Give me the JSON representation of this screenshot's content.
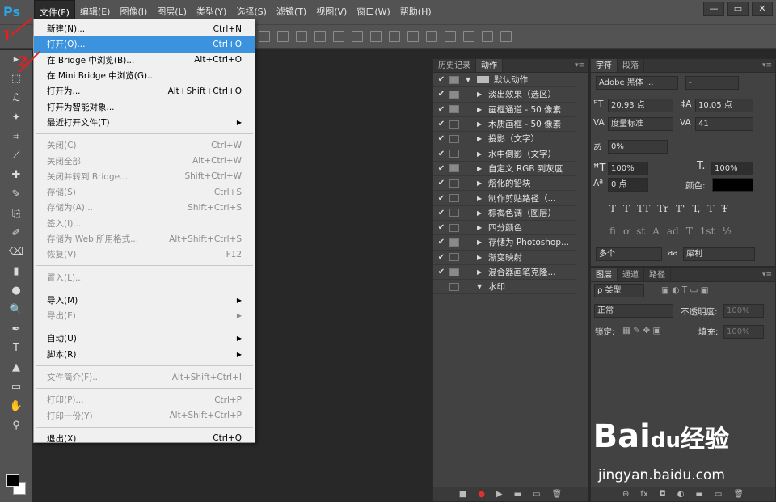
{
  "app": {
    "logo": "Ps"
  },
  "menubar": {
    "items": [
      "文件(F)",
      "编辑(E)",
      "图像(I)",
      "图层(L)",
      "类型(Y)",
      "选择(S)",
      "滤镜(T)",
      "视图(V)",
      "窗口(W)",
      "帮助(H)"
    ]
  },
  "window_controls": {
    "minimize": "—",
    "restore": "▭",
    "close": "✕"
  },
  "file_menu": {
    "items": [
      {
        "label": "新建(N)...",
        "shortcut": "Ctrl+N",
        "state": "enabled"
      },
      {
        "label": "打开(O)...",
        "shortcut": "Ctrl+O",
        "state": "highlighted"
      },
      {
        "label": "在 Bridge 中浏览(B)...",
        "shortcut": "Alt+Ctrl+O",
        "state": "enabled"
      },
      {
        "label": "在 Mini Bridge 中浏览(G)...",
        "shortcut": "",
        "state": "enabled"
      },
      {
        "label": "打开为...",
        "shortcut": "Alt+Shift+Ctrl+O",
        "state": "enabled"
      },
      {
        "label": "打开为智能对象...",
        "shortcut": "",
        "state": "enabled"
      },
      {
        "label": "最近打开文件(T)",
        "shortcut": "▶",
        "state": "enabled"
      },
      {
        "sep": true
      },
      {
        "label": "关闭(C)",
        "shortcut": "Ctrl+W",
        "state": "disabled"
      },
      {
        "label": "关闭全部",
        "shortcut": "Alt+Ctrl+W",
        "state": "disabled"
      },
      {
        "label": "关闭并转到 Bridge...",
        "shortcut": "Shift+Ctrl+W",
        "state": "disabled"
      },
      {
        "label": "存储(S)",
        "shortcut": "Ctrl+S",
        "state": "disabled"
      },
      {
        "label": "存储为(A)...",
        "shortcut": "Shift+Ctrl+S",
        "state": "disabled"
      },
      {
        "label": "签入(I)...",
        "shortcut": "",
        "state": "disabled"
      },
      {
        "label": "存储为 Web 所用格式...",
        "shortcut": "Alt+Shift+Ctrl+S",
        "state": "disabled"
      },
      {
        "label": "恢复(V)",
        "shortcut": "F12",
        "state": "disabled"
      },
      {
        "sep": true
      },
      {
        "label": "置入(L)...",
        "shortcut": "",
        "state": "disabled"
      },
      {
        "sep": true
      },
      {
        "label": "导入(M)",
        "shortcut": "▶",
        "state": "enabled"
      },
      {
        "label": "导出(E)",
        "shortcut": "▶",
        "state": "disabled"
      },
      {
        "sep": true
      },
      {
        "label": "自动(U)",
        "shortcut": "▶",
        "state": "enabled"
      },
      {
        "label": "脚本(R)",
        "shortcut": "▶",
        "state": "enabled"
      },
      {
        "sep": true
      },
      {
        "label": "文件简介(F)...",
        "shortcut": "Alt+Shift+Ctrl+I",
        "state": "disabled"
      },
      {
        "sep": true
      },
      {
        "label": "打印(P)...",
        "shortcut": "Ctrl+P",
        "state": "disabled"
      },
      {
        "label": "打印一份(Y)",
        "shortcut": "Alt+Shift+Ctrl+P",
        "state": "disabled"
      },
      {
        "sep": true
      },
      {
        "label": "退出(X)",
        "shortcut": "Ctrl+Q",
        "state": "enabled"
      }
    ]
  },
  "annotations": {
    "step1": "1",
    "step2": "2",
    "color": "#e32020"
  },
  "actions_panel": {
    "tabs": [
      "历史记录",
      "动作"
    ],
    "folder": "默认动作",
    "actions": [
      "淡出效果（选区）",
      "画框通道 - 50 像素",
      "木质画框 - 50 像素",
      "投影（文字）",
      "水中倒影（文字）",
      "自定义 RGB 到灰度",
      "熔化的铅块",
      "制作剪贴路径（...",
      "棕褐色调（图层）",
      "四分颜色",
      "存储为 Photoshop...",
      "渐变映射",
      "混合器画笔克隆..."
    ],
    "selected": "水印"
  },
  "character_panel": {
    "tabs": [
      "字符",
      "段落"
    ],
    "font_family": "Adobe 黑体 ...",
    "font_style": "-",
    "size": "20.93 点",
    "leading": "10.05 点",
    "kerning": "度量标准",
    "tracking": "41",
    "tsume": "0%",
    "vscale": "100%",
    "hscale": "100%",
    "baseline": "0 点",
    "color_label": "颜色:",
    "symbols": [
      "T",
      "T",
      "TT",
      "Tr",
      "T'",
      "T,",
      "T",
      "Ŧ"
    ],
    "ot_symbols": [
      "fi",
      "ơ",
      "st",
      "A",
      "ad",
      "T",
      "1st",
      "½"
    ],
    "language": "多个",
    "aa_label": "aa",
    "antialias": "犀利"
  },
  "layers_panel": {
    "tabs": [
      "图层",
      "通道",
      "路径"
    ],
    "filter": "ρ 类型",
    "blend_mode": "正常",
    "opacity_label": "不透明度:",
    "lock_label": "锁定:",
    "fill_label": "填充:"
  },
  "watermark": {
    "text": "Bai",
    "paw": "du",
    "cn": "经验",
    "url": "jingyan.baidu.com"
  }
}
